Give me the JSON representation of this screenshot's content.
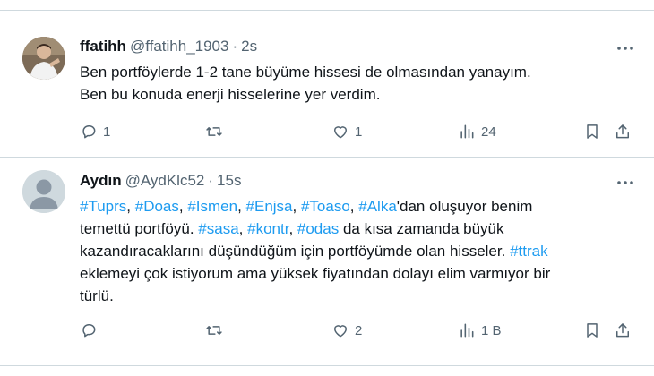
{
  "tweets": [
    {
      "display_name": "ffatihh",
      "handle": "@ffatihh_1903",
      "separator": "·",
      "time": "2s",
      "more_icon": "more-horizontal-icon",
      "avatar_kind": "photo",
      "lines": [
        [
          {
            "text": "Ben portföylerde 1-2 tane büyüme hissesi de olmasından yanayım.",
            "hashtag": false
          }
        ],
        [
          {
            "text": "Ben bu konuda enerji hisselerine yer verdim.",
            "hashtag": false
          }
        ]
      ],
      "actions": {
        "reply": {
          "icon": "reply-icon",
          "count": "1"
        },
        "retweet": {
          "icon": "retweet-icon",
          "count": ""
        },
        "like": {
          "icon": "heart-icon",
          "count": "1"
        },
        "views": {
          "icon": "views-icon",
          "count": "24"
        },
        "bookmark": {
          "icon": "bookmark-icon"
        },
        "share": {
          "icon": "share-icon"
        }
      }
    },
    {
      "display_name": "Aydın",
      "handle": "@AydKlc52",
      "separator": "·",
      "time": "15s",
      "more_icon": "more-horizontal-icon",
      "avatar_kind": "default-silhouette",
      "lines": [
        [
          {
            "text": "#Tuprs",
            "hashtag": true
          },
          {
            "text": ", ",
            "hashtag": false
          },
          {
            "text": "#Doas",
            "hashtag": true
          },
          {
            "text": ", ",
            "hashtag": false
          },
          {
            "text": "#Ismen",
            "hashtag": true
          },
          {
            "text": ", ",
            "hashtag": false
          },
          {
            "text": "#Enjsa",
            "hashtag": true
          },
          {
            "text": ", ",
            "hashtag": false
          },
          {
            "text": "#Toaso",
            "hashtag": true
          },
          {
            "text": ", ",
            "hashtag": false
          },
          {
            "text": "#Alka",
            "hashtag": true
          },
          {
            "text": "'dan oluşuyor benim",
            "hashtag": false
          }
        ],
        [
          {
            "text": "temettü portföyü. ",
            "hashtag": false
          },
          {
            "text": "#sasa",
            "hashtag": true
          },
          {
            "text": ", ",
            "hashtag": false
          },
          {
            "text": "#kontr",
            "hashtag": true
          },
          {
            "text": ", ",
            "hashtag": false
          },
          {
            "text": "#odas",
            "hashtag": true
          },
          {
            "text": " da kısa zamanda büyük",
            "hashtag": false
          }
        ],
        [
          {
            "text": "kazandıracaklarını düşündüğüm için portföyümde olan hisseler. ",
            "hashtag": false
          },
          {
            "text": "#ttrak",
            "hashtag": true
          }
        ],
        [
          {
            "text": "eklemeyi çok istiyorum ama yüksek fiyatından dolayı elim varmıyor bir",
            "hashtag": false
          }
        ],
        [
          {
            "text": "türlü.",
            "hashtag": false
          }
        ]
      ],
      "actions": {
        "reply": {
          "icon": "reply-icon",
          "count": ""
        },
        "retweet": {
          "icon": "retweet-icon",
          "count": ""
        },
        "like": {
          "icon": "heart-icon",
          "count": "2"
        },
        "views": {
          "icon": "views-icon",
          "count": "1 B"
        },
        "bookmark": {
          "icon": "bookmark-icon"
        },
        "share": {
          "icon": "share-icon"
        }
      }
    }
  ],
  "colors": {
    "text": "#0f1419",
    "secondary": "#536471",
    "hashtag": "#1d9bf0",
    "divider": "#cfd9de",
    "default_avatar": "#cfd9de"
  }
}
